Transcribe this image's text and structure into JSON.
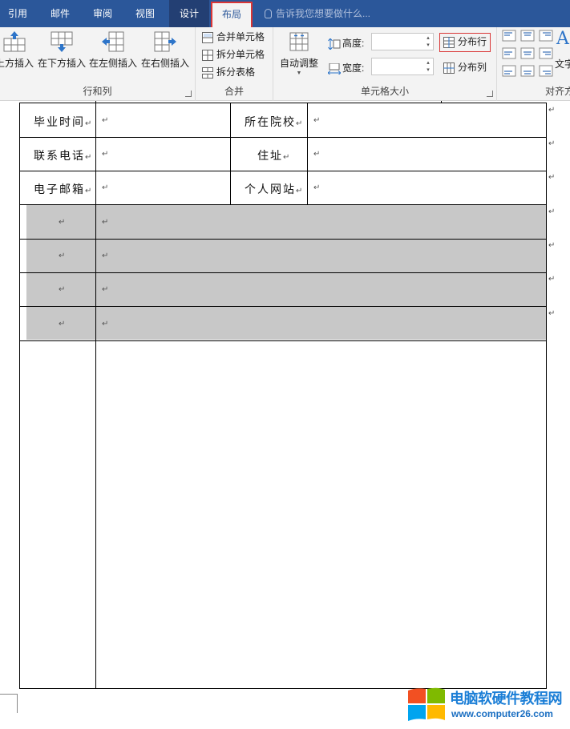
{
  "tabs": [
    {
      "label": "引用"
    },
    {
      "label": "邮件"
    },
    {
      "label": "审阅"
    },
    {
      "label": "视图"
    },
    {
      "label": "设计"
    },
    {
      "label": "布局"
    }
  ],
  "tell_me": "告诉我您想要做什么...",
  "ribbon": {
    "rows_cols": {
      "label": "行和列",
      "buttons": [
        "上方插入",
        "在下方插入",
        "在左侧插入",
        "在右侧插入"
      ]
    },
    "merge": {
      "label": "合并",
      "buttons": [
        "合并单元格",
        "拆分单元格",
        "拆分表格"
      ]
    },
    "cell_size": {
      "label": "单元格大小",
      "autofit": "自动调整",
      "height_label": "高度:",
      "width_label": "宽度:",
      "height_value": "",
      "width_value": "",
      "distribute_rows": "分布行",
      "distribute_cols": "分布列"
    },
    "alignment": {
      "label": "对齐方",
      "text_direction": "文字"
    }
  },
  "table": {
    "rows": [
      {
        "l1": "毕业时间",
        "l2": "所在院校"
      },
      {
        "l1": "联系电话",
        "l2": "住址"
      },
      {
        "l1": "电子邮箱",
        "l2": "个人网站"
      }
    ],
    "paragraph_mark": "↵"
  },
  "watermark": {
    "title": "电脑软硬件教程网",
    "url": "www.computer26.com",
    "colors": [
      "#f25022",
      "#7fba00",
      "#00a4ef",
      "#ffb900"
    ]
  }
}
